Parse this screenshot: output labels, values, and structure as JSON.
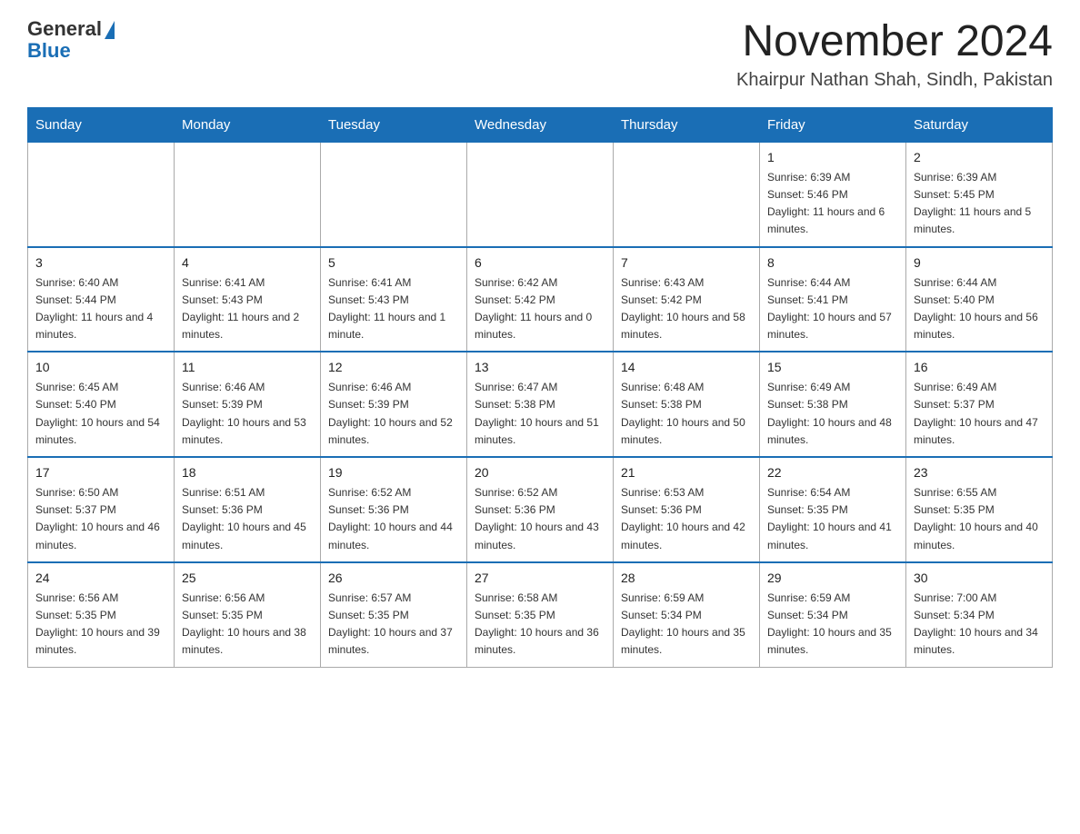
{
  "logo": {
    "general": "General",
    "triangle": "▶",
    "blue": "Blue"
  },
  "header": {
    "month_year": "November 2024",
    "location": "Khairpur Nathan Shah, Sindh, Pakistan"
  },
  "days_of_week": [
    "Sunday",
    "Monday",
    "Tuesday",
    "Wednesday",
    "Thursday",
    "Friday",
    "Saturday"
  ],
  "weeks": [
    [
      {
        "day": "",
        "info": ""
      },
      {
        "day": "",
        "info": ""
      },
      {
        "day": "",
        "info": ""
      },
      {
        "day": "",
        "info": ""
      },
      {
        "day": "",
        "info": ""
      },
      {
        "day": "1",
        "info": "Sunrise: 6:39 AM\nSunset: 5:46 PM\nDaylight: 11 hours and 6 minutes."
      },
      {
        "day": "2",
        "info": "Sunrise: 6:39 AM\nSunset: 5:45 PM\nDaylight: 11 hours and 5 minutes."
      }
    ],
    [
      {
        "day": "3",
        "info": "Sunrise: 6:40 AM\nSunset: 5:44 PM\nDaylight: 11 hours and 4 minutes."
      },
      {
        "day": "4",
        "info": "Sunrise: 6:41 AM\nSunset: 5:43 PM\nDaylight: 11 hours and 2 minutes."
      },
      {
        "day": "5",
        "info": "Sunrise: 6:41 AM\nSunset: 5:43 PM\nDaylight: 11 hours and 1 minute."
      },
      {
        "day": "6",
        "info": "Sunrise: 6:42 AM\nSunset: 5:42 PM\nDaylight: 11 hours and 0 minutes."
      },
      {
        "day": "7",
        "info": "Sunrise: 6:43 AM\nSunset: 5:42 PM\nDaylight: 10 hours and 58 minutes."
      },
      {
        "day": "8",
        "info": "Sunrise: 6:44 AM\nSunset: 5:41 PM\nDaylight: 10 hours and 57 minutes."
      },
      {
        "day": "9",
        "info": "Sunrise: 6:44 AM\nSunset: 5:40 PM\nDaylight: 10 hours and 56 minutes."
      }
    ],
    [
      {
        "day": "10",
        "info": "Sunrise: 6:45 AM\nSunset: 5:40 PM\nDaylight: 10 hours and 54 minutes."
      },
      {
        "day": "11",
        "info": "Sunrise: 6:46 AM\nSunset: 5:39 PM\nDaylight: 10 hours and 53 minutes."
      },
      {
        "day": "12",
        "info": "Sunrise: 6:46 AM\nSunset: 5:39 PM\nDaylight: 10 hours and 52 minutes."
      },
      {
        "day": "13",
        "info": "Sunrise: 6:47 AM\nSunset: 5:38 PM\nDaylight: 10 hours and 51 minutes."
      },
      {
        "day": "14",
        "info": "Sunrise: 6:48 AM\nSunset: 5:38 PM\nDaylight: 10 hours and 50 minutes."
      },
      {
        "day": "15",
        "info": "Sunrise: 6:49 AM\nSunset: 5:38 PM\nDaylight: 10 hours and 48 minutes."
      },
      {
        "day": "16",
        "info": "Sunrise: 6:49 AM\nSunset: 5:37 PM\nDaylight: 10 hours and 47 minutes."
      }
    ],
    [
      {
        "day": "17",
        "info": "Sunrise: 6:50 AM\nSunset: 5:37 PM\nDaylight: 10 hours and 46 minutes."
      },
      {
        "day": "18",
        "info": "Sunrise: 6:51 AM\nSunset: 5:36 PM\nDaylight: 10 hours and 45 minutes."
      },
      {
        "day": "19",
        "info": "Sunrise: 6:52 AM\nSunset: 5:36 PM\nDaylight: 10 hours and 44 minutes."
      },
      {
        "day": "20",
        "info": "Sunrise: 6:52 AM\nSunset: 5:36 PM\nDaylight: 10 hours and 43 minutes."
      },
      {
        "day": "21",
        "info": "Sunrise: 6:53 AM\nSunset: 5:36 PM\nDaylight: 10 hours and 42 minutes."
      },
      {
        "day": "22",
        "info": "Sunrise: 6:54 AM\nSunset: 5:35 PM\nDaylight: 10 hours and 41 minutes."
      },
      {
        "day": "23",
        "info": "Sunrise: 6:55 AM\nSunset: 5:35 PM\nDaylight: 10 hours and 40 minutes."
      }
    ],
    [
      {
        "day": "24",
        "info": "Sunrise: 6:56 AM\nSunset: 5:35 PM\nDaylight: 10 hours and 39 minutes."
      },
      {
        "day": "25",
        "info": "Sunrise: 6:56 AM\nSunset: 5:35 PM\nDaylight: 10 hours and 38 minutes."
      },
      {
        "day": "26",
        "info": "Sunrise: 6:57 AM\nSunset: 5:35 PM\nDaylight: 10 hours and 37 minutes."
      },
      {
        "day": "27",
        "info": "Sunrise: 6:58 AM\nSunset: 5:35 PM\nDaylight: 10 hours and 36 minutes."
      },
      {
        "day": "28",
        "info": "Sunrise: 6:59 AM\nSunset: 5:34 PM\nDaylight: 10 hours and 35 minutes."
      },
      {
        "day": "29",
        "info": "Sunrise: 6:59 AM\nSunset: 5:34 PM\nDaylight: 10 hours and 35 minutes."
      },
      {
        "day": "30",
        "info": "Sunrise: 7:00 AM\nSunset: 5:34 PM\nDaylight: 10 hours and 34 minutes."
      }
    ]
  ]
}
